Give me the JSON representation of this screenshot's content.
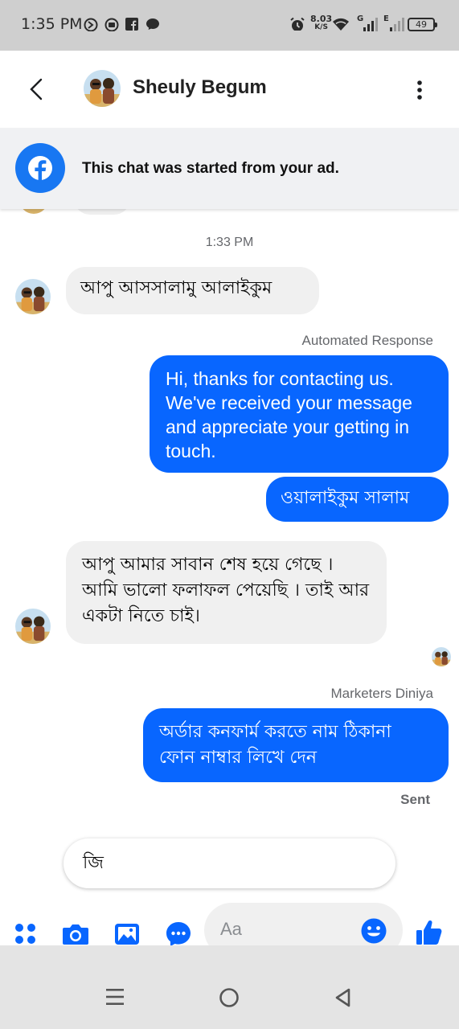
{
  "status_bar": {
    "time": "1:35 PM",
    "network_speed": "8.03",
    "network_unit": "K/S",
    "battery": "49",
    "signal_1": "G",
    "signal_2": "E"
  },
  "header": {
    "contact_name": "Sheuly Begum",
    "back_icon": "back-arrow-icon",
    "menu_icon": "more-vertical-icon"
  },
  "ad_banner": {
    "text": "This chat was started from your ad."
  },
  "chat": {
    "timestamp": "1:33 PM",
    "messages": [
      {
        "direction": "incoming",
        "text": "আপু আসসালামু আলাইকুম"
      },
      {
        "direction": "outgoing",
        "label": "Automated Response",
        "text": "Hi, thanks for contacting us. We've received your message and appreciate your getting in touch."
      },
      {
        "direction": "outgoing",
        "text": "ওয়ালাইকুম সালাম"
      },
      {
        "direction": "incoming",
        "text": "আপু আমার সাবান শেষ হয়ে গেছে । আমি ভালো ফলাফল  পেয়েছি । তাই আর একটা নিতে চাই।"
      },
      {
        "direction": "outgoing",
        "label": "Marketers Diniya",
        "text": "অর্ডার কনফার্ম করতে নাম ঠিকানা ফোন নাম্বার লিখে দেন"
      }
    ],
    "sent_status": "Sent",
    "quick_reply": "জি"
  },
  "composer": {
    "placeholder": "Aa",
    "icons": [
      "apps-icon",
      "camera-icon",
      "gallery-icon",
      "chat-bubble-icon",
      "emoji-icon",
      "like-icon"
    ]
  },
  "colors": {
    "accent": "#0866ff",
    "incoming_bubble": "#f0f0f0",
    "banner": "#f0f1f3"
  }
}
